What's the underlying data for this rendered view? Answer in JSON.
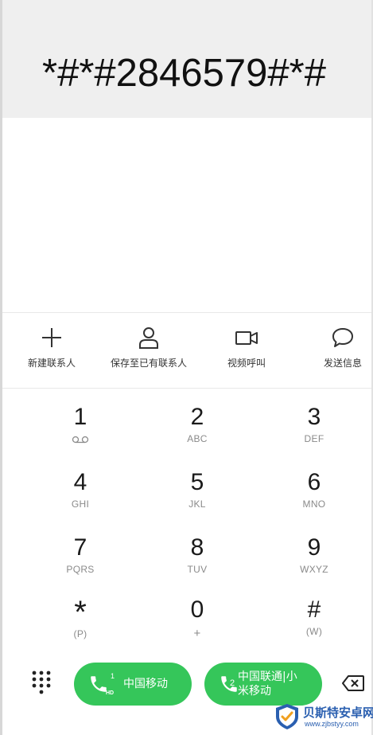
{
  "dialer": {
    "number": "*#*#2846579#*#"
  },
  "actions": {
    "new_contact": "新建联系人",
    "save_existing": "保存至已有联系人",
    "video_call": "视频呼叫",
    "send_message": "发送信息"
  },
  "keypad": {
    "k1": {
      "digit": "1",
      "letters": ""
    },
    "k2": {
      "digit": "2",
      "letters": "ABC"
    },
    "k3": {
      "digit": "3",
      "letters": "DEF"
    },
    "k4": {
      "digit": "4",
      "letters": "GHI"
    },
    "k5": {
      "digit": "5",
      "letters": "JKL"
    },
    "k6": {
      "digit": "6",
      "letters": "MNO"
    },
    "k7": {
      "digit": "7",
      "letters": "PQRS"
    },
    "k8": {
      "digit": "8",
      "letters": "TUV"
    },
    "k9": {
      "digit": "9",
      "letters": "WXYZ"
    },
    "kstar": {
      "digit": "*",
      "letters": "(P)"
    },
    "k0": {
      "digit": "0",
      "letters": "+"
    },
    "khash": {
      "digit": "#",
      "letters": "(W)"
    }
  },
  "calls": {
    "sim1": {
      "sim": "1",
      "badge": "HD",
      "carrier": "中国移动"
    },
    "sim2": {
      "sim": "2",
      "carrier_line1": "中国联通|小",
      "carrier_line2": "米移动"
    }
  },
  "watermark": {
    "name": "贝斯特安卓网",
    "url": "www.zjbstyy.com"
  },
  "colors": {
    "call_green": "#35c65a",
    "display_bg": "#efefef",
    "watermark_blue": "#2a5fb0"
  }
}
